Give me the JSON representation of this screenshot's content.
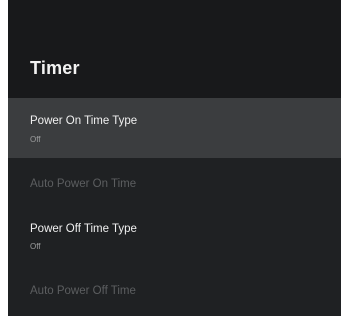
{
  "screen": {
    "title": "Timer"
  },
  "menu": {
    "items": [
      {
        "label": "Power On Time Type",
        "value": "Off",
        "focused": true,
        "enabled": true
      },
      {
        "label": "Auto Power On Time",
        "value": "",
        "focused": false,
        "enabled": false
      },
      {
        "label": "Power Off Time Type",
        "value": "Off",
        "focused": false,
        "enabled": true
      },
      {
        "label": "Auto Power Off Time",
        "value": "",
        "focused": false,
        "enabled": false
      }
    ]
  },
  "colors": {
    "background": "#1f2123",
    "header_background": "#18191b",
    "focused_row": "#3b3d3f",
    "text_primary": "#f0f0f0",
    "text_secondary": "#9c9d9e",
    "text_disabled": "#5c5e60"
  }
}
